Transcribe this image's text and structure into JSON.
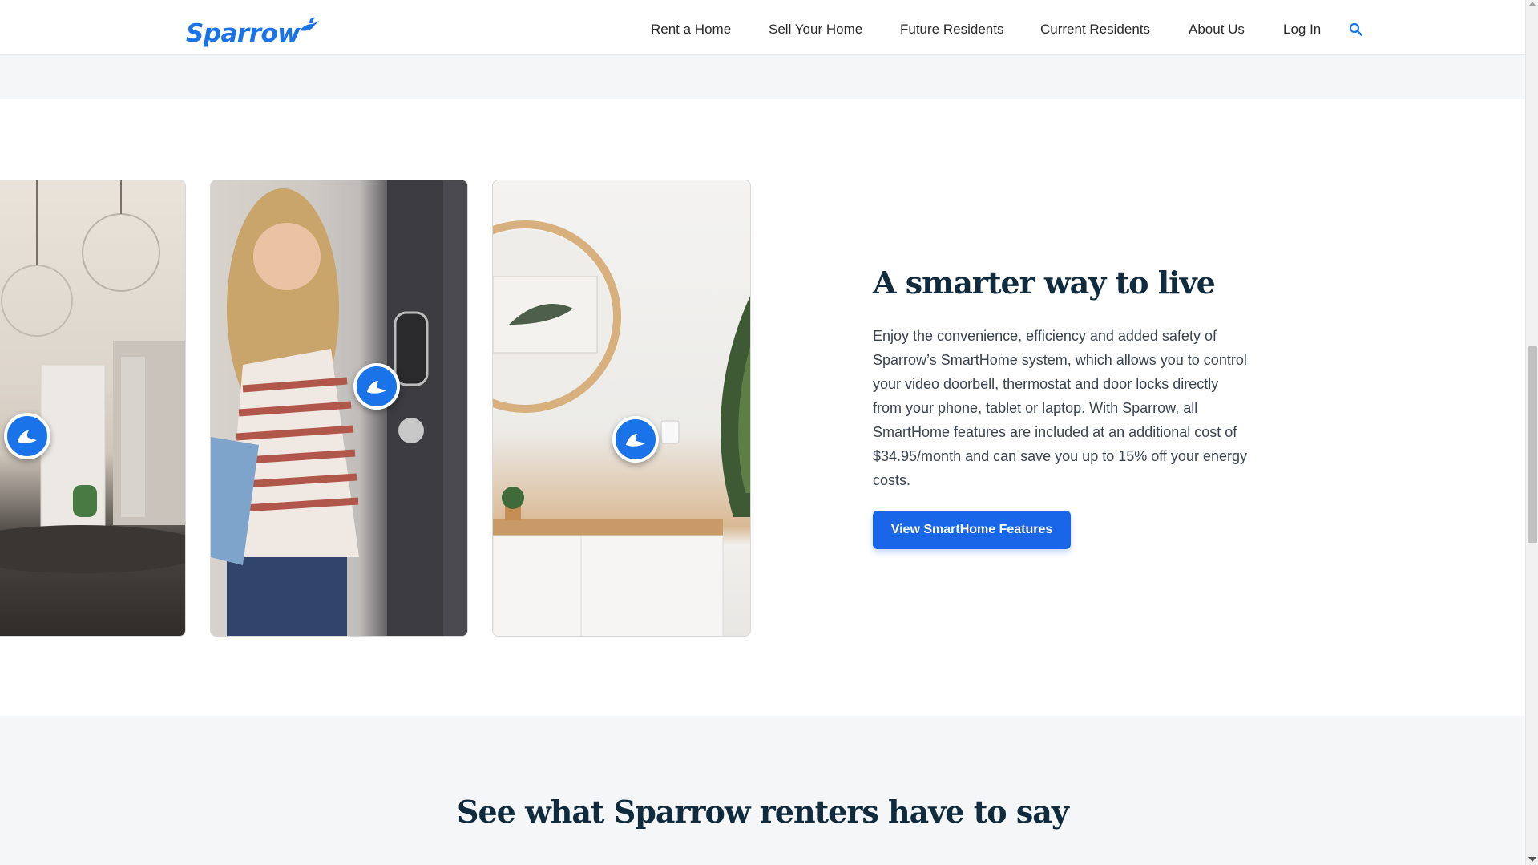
{
  "brand": {
    "name": "Sparrow",
    "color": "#1a73e8"
  },
  "nav": {
    "items": [
      {
        "label": "Rent a Home"
      },
      {
        "label": "Sell Your Home"
      },
      {
        "label": "Future Residents"
      },
      {
        "label": "Current Residents"
      },
      {
        "label": "About Us"
      },
      {
        "label": "Log In"
      }
    ],
    "search_icon": "search-icon"
  },
  "gallery": {
    "cards": [
      {
        "name": "kitchen-photo",
        "pin_icon": "sparrow-bird-icon"
      },
      {
        "name": "front-door-smart-lock-photo",
        "pin_icon": "sparrow-bird-icon"
      },
      {
        "name": "thermostat-hallway-photo",
        "pin_icon": "sparrow-bird-icon"
      }
    ]
  },
  "feature": {
    "title": "A smarter way to live",
    "body": "Enjoy the convenience, efficiency and added safety of Sparrow’s SmartHome system, which allows you to control your video doorbell, thermostat and door locks directly from your phone, tablet or laptop. With Sparrow, all SmartHome features are included at an additional cost of $34.95/month and can save you up to 15% off your energy costs.",
    "cta_label": "View SmartHome Features"
  },
  "testimonials": {
    "title": "See what Sparrow renters have to say"
  }
}
